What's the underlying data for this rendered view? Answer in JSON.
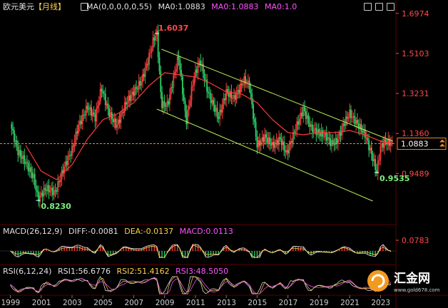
{
  "header": {
    "symbol": "欧元美元",
    "period": "【月线】",
    "ma_label": "MA(0,0,0,0,0,55)",
    "ma_value": "MA0:1.0883",
    "ma0_a": "MA0:1.0883",
    "ma0_b": "MA0:1.0"
  },
  "macd_header": {
    "name": "MACD(26,12,9)",
    "diff": "DIFF:-0.0081",
    "dea": "DEA:-0.0137",
    "macd": "MACD:0.0113"
  },
  "rsi_header": {
    "name": "RSI(6,12,24)",
    "rsi1": "RSI1:56.6776",
    "rsi2": "RSI2:51.4162",
    "rsi3": "RSI3:48.5050"
  },
  "watermark": {
    "name": "汇金网",
    "url": "www.gold678.com"
  },
  "colors": {
    "up": "#ff3b3b",
    "down": "#2bd46a",
    "ma": "#ff3b3b",
    "channel": "#b8f05a",
    "current_line": "#e98a2a",
    "axis_text": "#ff4a4a",
    "grid": "#3a0000"
  },
  "chart_data": {
    "type": "candlestick",
    "title": "欧元美元【月线】",
    "price_axis_ticks": [
      1.6974,
      1.5103,
      1.3231,
      1.136,
      0.9489,
      0.0783
    ],
    "current_price": 1.0883,
    "x_ticks": [
      "1999",
      "2001",
      "2003",
      "2005",
      "2007",
      "2009",
      "2011",
      "2013",
      "2015",
      "2017",
      "2019",
      "2021",
      "2023"
    ],
    "annotations": [
      {
        "text": "1.6037",
        "year": 2008.5,
        "price": 1.6037
      },
      {
        "text": "0.8230",
        "year": 2000.8,
        "price": 0.823
      },
      {
        "text": "0.9535",
        "year": 2022.75,
        "price": 0.9535
      }
    ],
    "price_series": {
      "name": "EURUSD monthly",
      "points": [
        [
          1999.0,
          1.18
        ],
        [
          1999.5,
          1.05
        ],
        [
          2000.0,
          1.0
        ],
        [
          2000.5,
          0.93
        ],
        [
          2000.8,
          0.83
        ],
        [
          2001.3,
          0.88
        ],
        [
          2001.9,
          0.86
        ],
        [
          2002.5,
          0.98
        ],
        [
          2003.0,
          1.06
        ],
        [
          2003.4,
          1.17
        ],
        [
          2004.0,
          1.26
        ],
        [
          2004.5,
          1.21
        ],
        [
          2004.9,
          1.35
        ],
        [
          2005.4,
          1.23
        ],
        [
          2005.9,
          1.17
        ],
        [
          2006.5,
          1.28
        ],
        [
          2006.9,
          1.32
        ],
        [
          2007.5,
          1.38
        ],
        [
          2007.9,
          1.47
        ],
        [
          2008.3,
          1.58
        ],
        [
          2008.5,
          1.6037
        ],
        [
          2008.8,
          1.27
        ],
        [
          2009.2,
          1.27
        ],
        [
          2009.9,
          1.5
        ],
        [
          2010.4,
          1.19
        ],
        [
          2010.9,
          1.4
        ],
        [
          2011.3,
          1.48
        ],
        [
          2011.8,
          1.33
        ],
        [
          2012.5,
          1.21
        ],
        [
          2013.0,
          1.33
        ],
        [
          2013.5,
          1.3
        ],
        [
          2014.2,
          1.39
        ],
        [
          2014.5,
          1.36
        ],
        [
          2015.0,
          1.08
        ],
        [
          2015.5,
          1.12
        ],
        [
          2016.0,
          1.08
        ],
        [
          2016.5,
          1.11
        ],
        [
          2016.9,
          1.04
        ],
        [
          2017.5,
          1.16
        ],
        [
          2018.0,
          1.25
        ],
        [
          2018.5,
          1.16
        ],
        [
          2019.0,
          1.14
        ],
        [
          2019.5,
          1.12
        ],
        [
          2019.8,
          1.09
        ],
        [
          2020.2,
          1.1
        ],
        [
          2020.6,
          1.18
        ],
        [
          2021.0,
          1.23
        ],
        [
          2021.5,
          1.18
        ],
        [
          2022.0,
          1.13
        ],
        [
          2022.5,
          1.02
        ],
        [
          2022.75,
          0.9535
        ],
        [
          2023.0,
          1.07
        ],
        [
          2023.3,
          1.1
        ],
        [
          2023.6,
          1.09
        ],
        [
          2023.8,
          1.0883
        ]
      ]
    },
    "ma_series": {
      "name": "MA0",
      "points": [
        [
          2000.0,
          1.08
        ],
        [
          2001.0,
          0.96
        ],
        [
          2002.0,
          0.92
        ],
        [
          2003.0,
          0.99
        ],
        [
          2004.0,
          1.11
        ],
        [
          2005.0,
          1.2
        ],
        [
          2006.0,
          1.23
        ],
        [
          2007.0,
          1.28
        ],
        [
          2008.0,
          1.36
        ],
        [
          2009.0,
          1.42
        ],
        [
          2010.0,
          1.41
        ],
        [
          2011.0,
          1.4
        ],
        [
          2012.0,
          1.37
        ],
        [
          2013.0,
          1.33
        ],
        [
          2014.0,
          1.32
        ],
        [
          2015.0,
          1.28
        ],
        [
          2016.0,
          1.2
        ],
        [
          2017.0,
          1.14
        ],
        [
          2018.0,
          1.13
        ],
        [
          2019.0,
          1.14
        ],
        [
          2020.0,
          1.14
        ],
        [
          2021.0,
          1.15
        ],
        [
          2022.0,
          1.13
        ],
        [
          2023.0,
          1.1
        ],
        [
          2023.8,
          1.09
        ]
      ]
    },
    "channel": [
      {
        "from": [
          2008.8,
          1.53
        ],
        "to": [
          2023.8,
          1.1
        ]
      },
      {
        "from": [
          2008.5,
          1.25
        ],
        "to": [
          2022.5,
          0.82
        ]
      }
    ],
    "macd": {
      "diff": -0.0081,
      "dea": -0.0137,
      "macd": 0.0113
    },
    "rsi": {
      "rsi1": 56.6776,
      "rsi2": 51.4162,
      "rsi3": 48.505
    }
  }
}
